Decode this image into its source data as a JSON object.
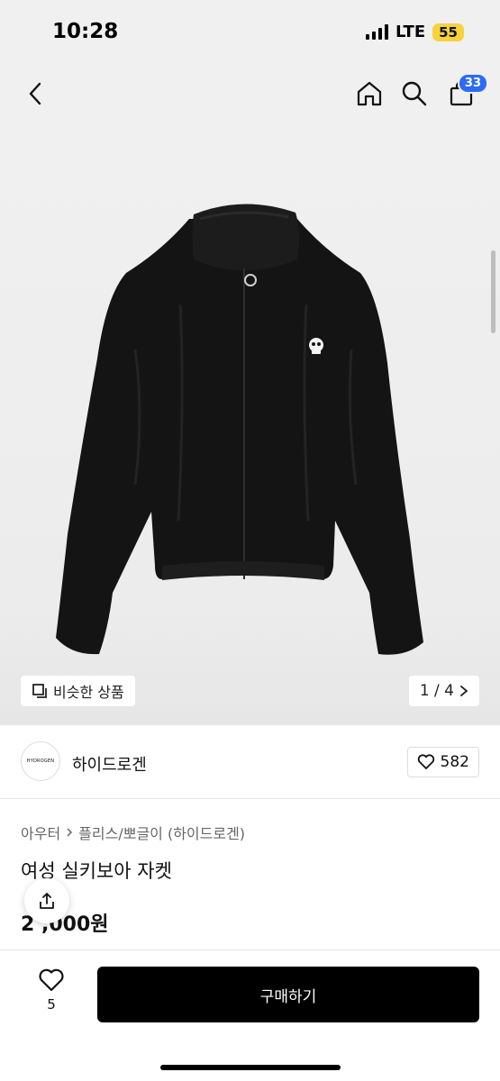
{
  "status": {
    "time": "10:28",
    "network": "LTE",
    "battery": "55"
  },
  "nav": {
    "cart_count": "33"
  },
  "gallery": {
    "similar_label": "비슷한 상품",
    "page_indicator": "1 / 4"
  },
  "shop": {
    "logo_text": "HYDROGEN",
    "name": "하이드로겐",
    "like_count": "582"
  },
  "product": {
    "breadcrumb": [
      "아우터",
      "플리스/뽀글이 (하이드로겐)"
    ],
    "title": "여성 실키보아 자켓",
    "price": "2 ,000원"
  },
  "bottom": {
    "wish_count": "5",
    "buy_label": "구매하기"
  },
  "colors": {
    "accent_badge": "#2c6cf5",
    "buy_button": "#000000",
    "battery": "#f7d23b"
  }
}
